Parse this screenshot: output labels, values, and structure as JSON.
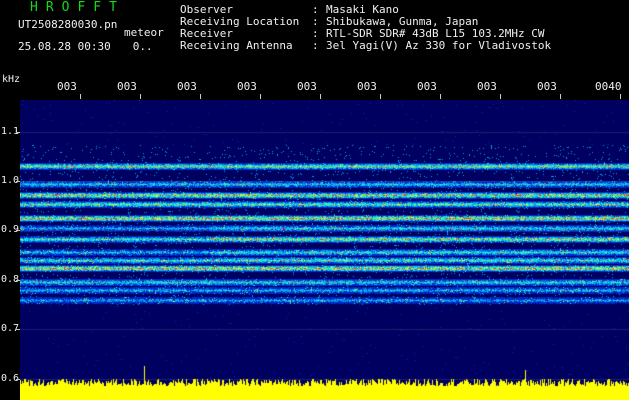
{
  "header": {
    "brand": "HROFFT",
    "filename": "UT2508280030.pn",
    "product": "meteor",
    "date": "25.08.28",
    "time": "00:30",
    "count": "0.."
  },
  "meta": [
    {
      "key": "Observer",
      "value": "Masaki Kano"
    },
    {
      "key": "Receiving Location",
      "value": "Shibukawa, Gunma, Japan"
    },
    {
      "key": "Receiver",
      "value": "RTL-SDR SDR# 43dB L15 103.2MHz CW"
    },
    {
      "key": "Receiving Antenna",
      "value": "3el Yagi(V) Az 330 for Vladivostok"
    }
  ],
  "axes": {
    "y_unit": "kHz",
    "y_ticks": [
      {
        "label": "1.1",
        "value": 1.1
      },
      {
        "label": "1.0",
        "value": 1.0
      },
      {
        "label": "0.9",
        "value": 0.9
      },
      {
        "label": "0.8",
        "value": 0.8
      },
      {
        "label": "0.7",
        "value": 0.7
      },
      {
        "label": "0.6",
        "value": 0.6
      }
    ],
    "x_ticks": [
      "003",
      "003",
      "003",
      "003",
      "003",
      "003",
      "003",
      "003",
      "003",
      "0040"
    ]
  },
  "colors": {
    "background": "#000000",
    "plot_background": "#000060",
    "brand": "#16d816",
    "text": "#f0f0f0",
    "amplitude": "#ffff00"
  }
}
